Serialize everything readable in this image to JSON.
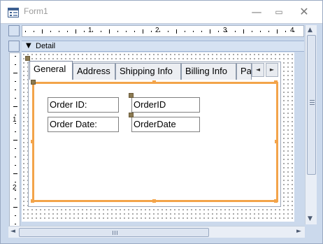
{
  "window": {
    "title": "Form1",
    "minimize_icon": "minimize-icon",
    "maximize_icon": "maximize-icon",
    "close_icon": "close-icon"
  },
  "ruler": {
    "horizontal_numbers": [
      "1",
      "2",
      "3",
      "4"
    ],
    "vertical_numbers": [
      "1",
      "2"
    ]
  },
  "section": {
    "label": "Detail",
    "arrow": "▼"
  },
  "tabs": [
    {
      "label": "General",
      "active": true
    },
    {
      "label": "Address",
      "active": false
    },
    {
      "label": "Shipping Info",
      "active": false
    },
    {
      "label": "Billing Info",
      "active": false
    },
    {
      "label": "Pa",
      "active": false
    }
  ],
  "tab_nav": {
    "prev": "◄",
    "next": "►"
  },
  "controls": {
    "order_id_label": "Order ID:",
    "order_id_field": "OrderID",
    "order_date_label": "Order Date:",
    "order_date_field": "OrderDate"
  },
  "colors": {
    "selection": "#f3a44a",
    "handle": "#8b7a52",
    "chrome": "#cbd9ec"
  }
}
